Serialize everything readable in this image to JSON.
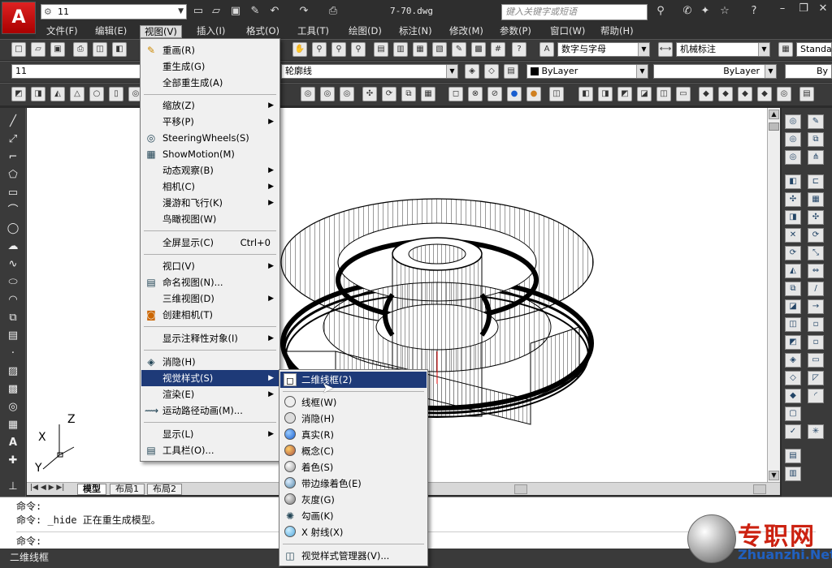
{
  "app": {
    "logo_letter": "A",
    "workspace": "11",
    "document_title": "7-70.dwg",
    "search_placeholder": "键入关键字或短语"
  },
  "menubar": {
    "items": [
      "文件(F)",
      "编辑(E)",
      "视图(V)",
      "插入(I)",
      "格式(O)",
      "工具(T)",
      "绘图(D)",
      "标注(N)",
      "修改(M)",
      "参数(P)",
      "窗口(W)",
      "帮助(H)"
    ],
    "active": "视图(V)"
  },
  "toolbars": {
    "text_style": "数字与字母",
    "dim_style": "机械标注",
    "table_style": "Standa",
    "layer_value": "11",
    "layer_name": "轮廓线",
    "color": "ByLayer",
    "linetype": "ByLayer",
    "lineweight": "By"
  },
  "view_menu": {
    "items": [
      {
        "label": "重画(R)",
        "icon": "redraw-icon"
      },
      {
        "label": "重生成(G)"
      },
      {
        "label": "全部重生成(A)"
      },
      {
        "label": "缩放(Z)",
        "submenu": true
      },
      {
        "label": "平移(P)",
        "submenu": true
      },
      {
        "label": "SteeringWheels(S)",
        "icon": "wheel-icon"
      },
      {
        "label": "ShowMotion(M)",
        "icon": "showmotion-icon"
      },
      {
        "label": "动态观察(B)",
        "submenu": true
      },
      {
        "label": "相机(C)",
        "submenu": true
      },
      {
        "label": "漫游和飞行(K)",
        "submenu": true
      },
      {
        "label": "鸟瞰视图(W)"
      },
      {
        "label": "全屏显示(C)",
        "shortcut": "Ctrl+0"
      },
      {
        "label": "视口(V)",
        "submenu": true
      },
      {
        "label": "命名视图(N)...",
        "icon": "named-view-icon"
      },
      {
        "label": "三维视图(D)",
        "submenu": true
      },
      {
        "label": "创建相机(T)",
        "icon": "camera-icon"
      },
      {
        "label": "显示注释性对象(I)",
        "submenu": true
      },
      {
        "label": "消隐(H)",
        "icon": "hide-icon"
      },
      {
        "label": "视觉样式(S)",
        "submenu": true,
        "highlighted": true
      },
      {
        "label": "渲染(E)",
        "submenu": true
      },
      {
        "label": "运动路径动画(M)...",
        "icon": "motion-path-icon"
      },
      {
        "label": "显示(L)",
        "submenu": true
      },
      {
        "label": "工具栏(O)...",
        "icon": "toolbar-icon"
      }
    ]
  },
  "visual_styles_menu": {
    "items": [
      {
        "label": "二维线框(2)",
        "highlighted": true
      },
      {
        "label": "线框(W)"
      },
      {
        "label": "消隐(H)"
      },
      {
        "label": "真实(R)"
      },
      {
        "label": "概念(C)"
      },
      {
        "label": "着色(S)"
      },
      {
        "label": "带边缘着色(E)"
      },
      {
        "label": "灰度(G)"
      },
      {
        "label": "勾画(K)"
      },
      {
        "label": "X 射线(X)"
      },
      {
        "label": "视觉样式管理器(V)..."
      }
    ]
  },
  "layout_tabs": [
    "模型",
    "布局1",
    "布局2"
  ],
  "ucs": {
    "x": "X",
    "y": "Y",
    "z": "Z"
  },
  "command_line": {
    "line1": "命令:",
    "line2": "命令: _hide 正在重生成模型。",
    "prompt": "命令:"
  },
  "status_text": "二维线框",
  "watermark": {
    "text": "专职网",
    "url": "Zhuanzhi.Net"
  },
  "colors": {
    "highlight": "#1e3a78",
    "title_bg": "#2e2e2e",
    "logo_red": "#cc2222"
  }
}
